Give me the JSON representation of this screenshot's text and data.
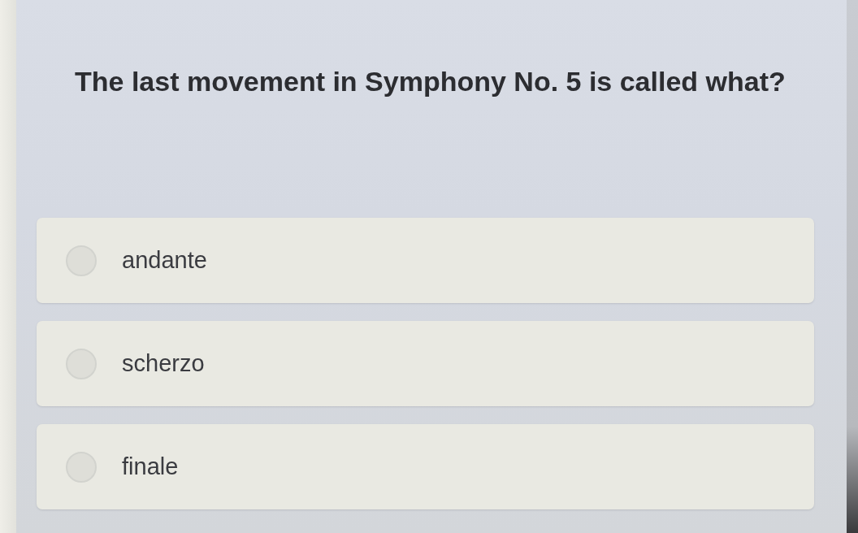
{
  "question": {
    "text": "The last movement in Symphony No. 5 is called what?"
  },
  "options": [
    {
      "label": "andante",
      "selected": false
    },
    {
      "label": "scherzo",
      "selected": false
    },
    {
      "label": "finale",
      "selected": false
    }
  ]
}
